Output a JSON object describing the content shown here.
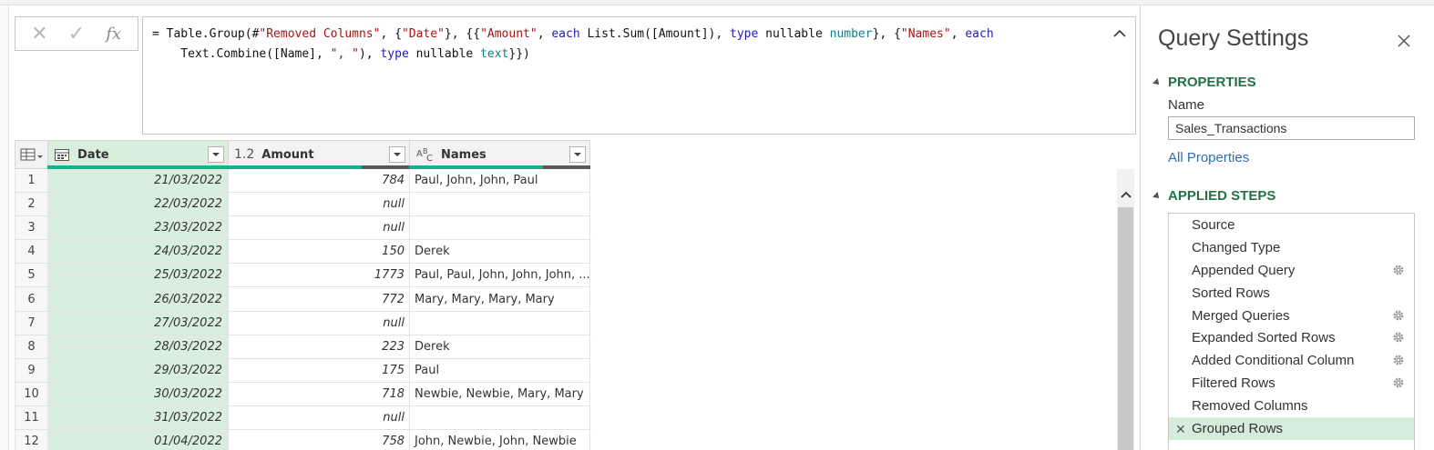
{
  "formula_bar": {
    "cancel_icon": "✕",
    "confirm_icon": "✓",
    "fx_icon": "fx",
    "formula_line1": "= Table.Group(#\"Removed Columns\", {\"Date\"}, {{\"Amount\", each List.Sum([Amount]), type nullable number}, {\"Names\", each",
    "formula_line2": "Text.Combine([Name], \", \"), type nullable text}})"
  },
  "table": {
    "columns": [
      {
        "label": "Date",
        "type_icon": "date-type-icon"
      },
      {
        "label": "Amount",
        "type_icon": "1.2"
      },
      {
        "label": "Names",
        "type_icon": "ABC"
      }
    ],
    "rows": [
      {
        "idx": "1",
        "date": "21/03/2022",
        "amount": "784",
        "names": "Paul, John, John, Paul"
      },
      {
        "idx": "2",
        "date": "22/03/2022",
        "amount": "null",
        "names": ""
      },
      {
        "idx": "3",
        "date": "23/03/2022",
        "amount": "null",
        "names": ""
      },
      {
        "idx": "4",
        "date": "24/03/2022",
        "amount": "150",
        "names": "Derek"
      },
      {
        "idx": "5",
        "date": "25/03/2022",
        "amount": "1773",
        "names": "Paul, Paul, John, John, John, ..."
      },
      {
        "idx": "6",
        "date": "26/03/2022",
        "amount": "772",
        "names": "Mary, Mary, Mary, Mary"
      },
      {
        "idx": "7",
        "date": "27/03/2022",
        "amount": "null",
        "names": ""
      },
      {
        "idx": "8",
        "date": "28/03/2022",
        "amount": "223",
        "names": "Derek"
      },
      {
        "idx": "9",
        "date": "29/03/2022",
        "amount": "175",
        "names": "Paul"
      },
      {
        "idx": "10",
        "date": "30/03/2022",
        "amount": "718",
        "names": "Newbie, Newbie, Mary, Mary"
      },
      {
        "idx": "11",
        "date": "31/03/2022",
        "amount": "null",
        "names": ""
      },
      {
        "idx": "12",
        "date": "01/04/2022",
        "amount": "758",
        "names": "John, Newbie, John, Newbie"
      }
    ]
  },
  "query_settings": {
    "title": "Query Settings",
    "properties_heading": "PROPERTIES",
    "name_label": "Name",
    "name_value": "Sales_Transactions",
    "all_properties_link": "All Properties",
    "applied_steps_heading": "APPLIED STEPS",
    "steps": [
      {
        "label": "Source",
        "has_gear": false,
        "active": false
      },
      {
        "label": "Changed Type",
        "has_gear": false,
        "active": false
      },
      {
        "label": "Appended Query",
        "has_gear": true,
        "active": false
      },
      {
        "label": "Sorted Rows",
        "has_gear": false,
        "active": false
      },
      {
        "label": "Merged Queries",
        "has_gear": true,
        "active": false
      },
      {
        "label": "Expanded Sorted Rows",
        "has_gear": true,
        "active": false
      },
      {
        "label": "Added Conditional Column",
        "has_gear": true,
        "active": false
      },
      {
        "label": "Filtered Rows",
        "has_gear": true,
        "active": false
      },
      {
        "label": "Removed Columns",
        "has_gear": false,
        "active": false
      },
      {
        "label": "Grouped Rows",
        "has_gear": false,
        "active": true
      }
    ]
  },
  "colors": {
    "accent_green": "#217346",
    "selected_column": "#d9eedd",
    "quality_bar": "#1ab08f",
    "link": "#2f6fb3"
  }
}
